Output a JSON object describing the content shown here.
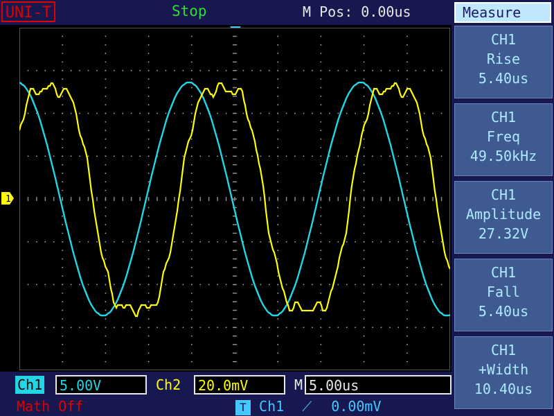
{
  "header": {
    "logo": "UNI-T",
    "status": "Stop",
    "mpos": "M Pos: 0.00us",
    "menu_title": "Measure"
  },
  "measurements": [
    {
      "channel": "CH1",
      "name": "Rise",
      "value": "5.40us"
    },
    {
      "channel": "CH1",
      "name": "Freq",
      "value": "49.50kHz"
    },
    {
      "channel": "CH1",
      "name": "Amplitude",
      "value": "27.32V"
    },
    {
      "channel": "CH1",
      "name": "Fall",
      "value": "5.40us"
    },
    {
      "channel": "CH1",
      "name": "+Width",
      "value": "10.40us"
    }
  ],
  "footer": {
    "ch1_label": "Ch1",
    "ch1_scale": "5.00V",
    "ch2_label": "Ch2",
    "ch2_scale": "20.0mV",
    "time_label": "M",
    "time_scale": "5.00us",
    "math": "Math Off",
    "trigger_icon": "T",
    "trigger_channel": "Ch1",
    "trigger_edge": "⟋",
    "trigger_level": "0.00mV"
  },
  "markers": {
    "ch1_ground": "1"
  },
  "colors": {
    "ch1_trace": "#ffff00",
    "ch2_trace": "#22d6e6",
    "grid": "#b0b0b0",
    "panel": "#16184f"
  }
}
